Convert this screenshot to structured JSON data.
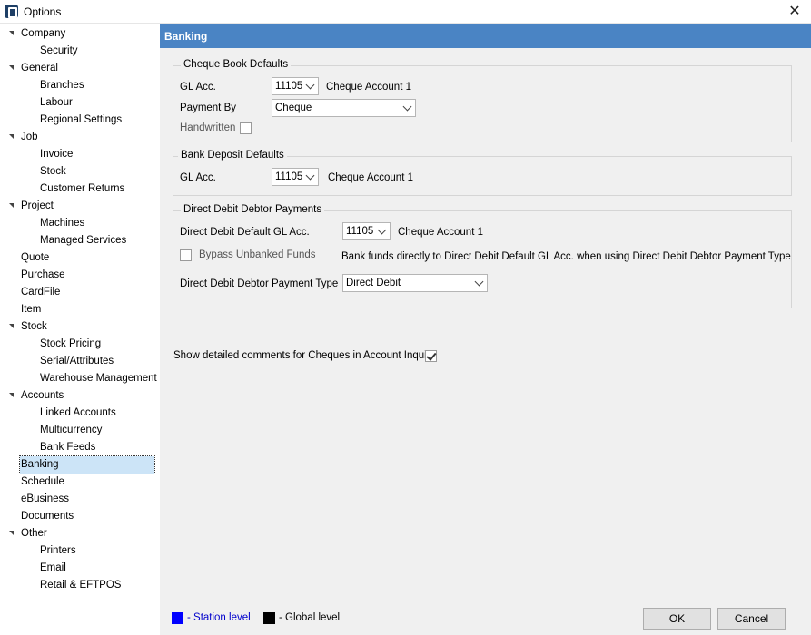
{
  "window": {
    "title": "Options",
    "close_symbol": "✕"
  },
  "sidebar": {
    "items": [
      {
        "label": "Company",
        "level": 0,
        "expanded": true
      },
      {
        "label": "Security",
        "level": 1
      },
      {
        "label": "General",
        "level": 0,
        "expanded": true
      },
      {
        "label": "Branches",
        "level": 1
      },
      {
        "label": "Labour",
        "level": 1
      },
      {
        "label": "Regional Settings",
        "level": 1
      },
      {
        "label": "Job",
        "level": 0,
        "expanded": true
      },
      {
        "label": "Invoice",
        "level": 1
      },
      {
        "label": "Stock",
        "level": 1
      },
      {
        "label": "Customer Returns",
        "level": 1
      },
      {
        "label": "Project",
        "level": 0,
        "expanded": true
      },
      {
        "label": "Machines",
        "level": 1
      },
      {
        "label": "Managed Services",
        "level": 1
      },
      {
        "label": "Quote",
        "level": 0
      },
      {
        "label": "Purchase",
        "level": 0
      },
      {
        "label": "CardFile",
        "level": 0
      },
      {
        "label": "Item",
        "level": 0
      },
      {
        "label": "Stock",
        "level": 0,
        "expanded": true
      },
      {
        "label": "Stock Pricing",
        "level": 1
      },
      {
        "label": "Serial/Attributes",
        "level": 1
      },
      {
        "label": "Warehouse Management",
        "level": 1
      },
      {
        "label": "Accounts",
        "level": 0,
        "expanded": true
      },
      {
        "label": "Linked Accounts",
        "level": 1
      },
      {
        "label": "Multicurrency",
        "level": 1
      },
      {
        "label": "Bank Feeds",
        "level": 1
      },
      {
        "label": "Banking",
        "level": 0,
        "selected": true
      },
      {
        "label": "Schedule",
        "level": 0
      },
      {
        "label": "eBusiness",
        "level": 0
      },
      {
        "label": "Documents",
        "level": 0
      },
      {
        "label": "Other",
        "level": 0,
        "expanded": true
      },
      {
        "label": "Printers",
        "level": 1
      },
      {
        "label": "Email",
        "level": 1
      },
      {
        "label": "Retail & EFTPOS",
        "level": 1
      }
    ]
  },
  "content": {
    "header": "Banking",
    "cheque_book": {
      "title": "Cheque Book Defaults",
      "gl_label": "GL Acc.",
      "gl_value": "11105",
      "gl_desc": "Cheque Account 1",
      "payment_by_label": "Payment By",
      "payment_by_value": "Cheque",
      "handwritten_label": "Handwritten",
      "handwritten_checked": false
    },
    "bank_deposit": {
      "title": "Bank Deposit Defaults",
      "gl_label": "GL Acc.",
      "gl_value": "11105",
      "gl_desc": "Cheque Account 1"
    },
    "direct_debit": {
      "title": "Direct Debit Debtor Payments",
      "default_gl_label": "Direct Debit Default GL Acc.",
      "default_gl_value": "11105",
      "default_gl_desc": "Cheque Account 1",
      "bypass_label": "Bypass Unbanked Funds",
      "bypass_checked": false,
      "bypass_desc": "Bank funds directly to Direct Debit Default GL Acc. when using Direct Debit Debtor Payment Type",
      "payment_type_label": "Direct Debit Debtor Payment Type",
      "payment_type_value": "Direct Debit"
    },
    "detailed_comments_label": "Show detailed comments for Cheques in Account Inquiry",
    "detailed_comments_checked": true
  },
  "footer": {
    "station_label": "- Station level",
    "station_color": "#0000ff",
    "global_label": "- Global level",
    "global_color": "#000000",
    "ok_label": "OK",
    "cancel_label": "Cancel"
  }
}
